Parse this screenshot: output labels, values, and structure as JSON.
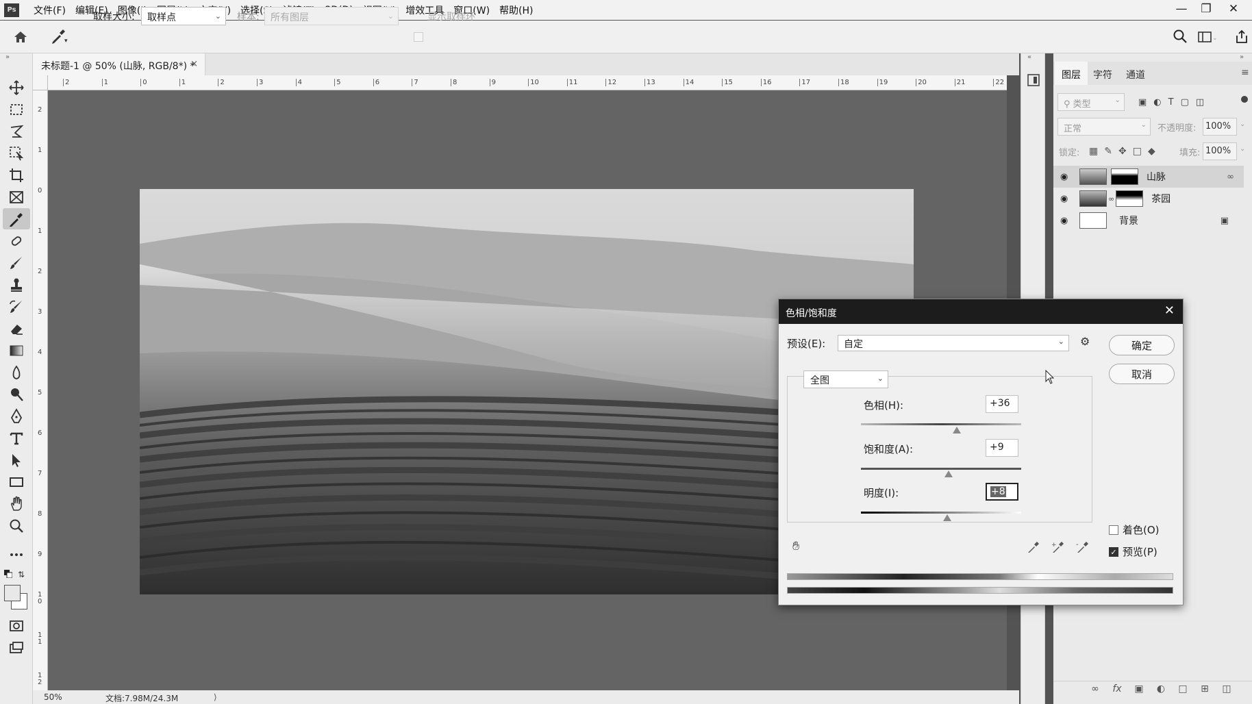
{
  "menu": [
    "文件(F)",
    "编辑(E)",
    "图像(I)",
    "图层(L)",
    "文字(Y)",
    "选择(S)",
    "滤镜(T)",
    "3D(D)",
    "视图(V)",
    "增效工具",
    "窗口(W)",
    "帮助(H)"
  ],
  "app_logo": "Ps",
  "options": {
    "sample_size_label": "取样大小:",
    "sample_size_value": "取样点",
    "sample_label": "样本:",
    "sample_value": "所有图层",
    "show_ring_label": "显示取样环"
  },
  "document": {
    "tab_title": "未标题-1 @ 50% (山脉, RGB/8*) *",
    "zoom": "50%",
    "doc_size": "文档:7.98M/24.3M"
  },
  "ruler": {
    "h_ticks": [
      "2",
      "1",
      "0",
      "1",
      "2",
      "3",
      "4",
      "5",
      "6",
      "7",
      "8",
      "9",
      "10",
      "11",
      "12",
      "13",
      "14",
      "15",
      "16",
      "17",
      "18",
      "19",
      "20",
      "21",
      "22"
    ],
    "v_ticks": [
      "2",
      "1",
      "0",
      "1",
      "2",
      "3",
      "4",
      "5",
      "6",
      "7",
      "8",
      "9",
      "1\n0",
      "1\n1",
      "1\n2"
    ]
  },
  "panel": {
    "tabs": [
      "图层",
      "字符",
      "通道"
    ],
    "filter_placeholder": "类型",
    "blend_mode": "正常",
    "opacity_label": "不透明度:",
    "opacity_value": "100%",
    "lock_label": "锁定:",
    "fill_label": "填充:",
    "fill_value": "100%",
    "layers": [
      {
        "name": "山脉",
        "selected": true,
        "locked": false
      },
      {
        "name": "茶园",
        "selected": false,
        "locked": false
      },
      {
        "name": "背景",
        "selected": false,
        "locked": true
      }
    ]
  },
  "dialog": {
    "title": "色相/饱和度",
    "preset_label": "预设(E):",
    "preset_value": "自定",
    "ok_label": "确定",
    "cancel_label": "取消",
    "channel_value": "全图",
    "hue_label": "色相(H):",
    "hue_value": "+36",
    "sat_label": "饱和度(A):",
    "sat_value": "+9",
    "light_label": "明度(I):",
    "light_value": "+8",
    "colorize_label": "着色(O)",
    "colorize_checked": false,
    "preview_label": "预览(P)",
    "preview_checked": true,
    "hue_level": 36,
    "sat_level": 9,
    "light_level": 8
  }
}
